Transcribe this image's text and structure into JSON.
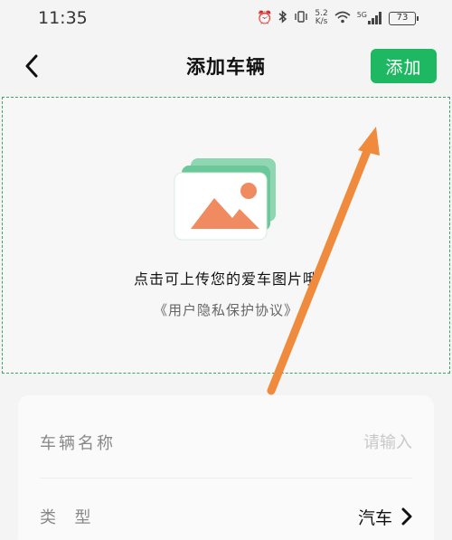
{
  "status_bar": {
    "time": "11:35",
    "net_speed_value": "5.2",
    "net_speed_unit": "K/s",
    "signal_label": "5G",
    "battery": "73",
    "icons": [
      "alarm-icon",
      "bluetooth-icon",
      "vibrate-icon",
      "wifi-icon",
      "signal-icon",
      "battery-icon"
    ]
  },
  "nav": {
    "title": "添加车辆",
    "add_label": "添加",
    "back_icon": "chevron-left-icon"
  },
  "upload": {
    "hint": "点击可上传您的爱车图片哦",
    "privacy_link": "《用户隐私保护协议》",
    "illustration_icon": "image-placeholder-icon"
  },
  "form": {
    "name_label": "车辆名称",
    "name_placeholder": "请输入",
    "name_value": "",
    "type_label": "类  型",
    "type_value": "汽车"
  },
  "colors": {
    "accent": "#1fb862",
    "dashed_border": "#3aa36a",
    "annotation_arrow": "#f08a3c"
  }
}
